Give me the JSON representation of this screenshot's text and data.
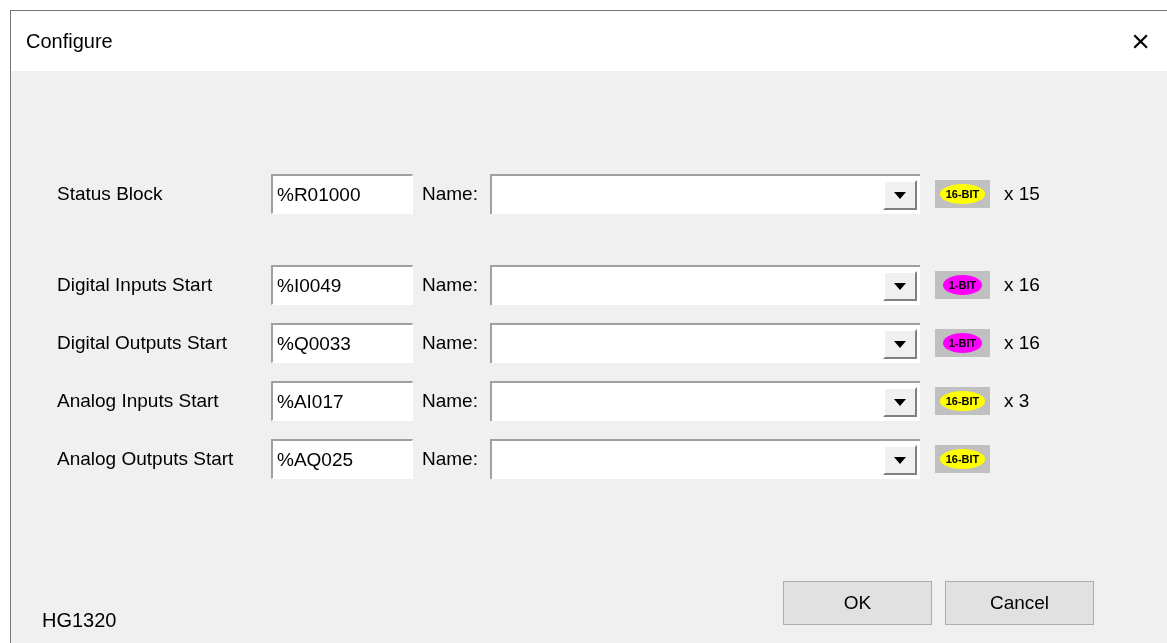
{
  "window": {
    "title": "Configure",
    "close": "×"
  },
  "status_block": {
    "label": "Status Block",
    "address": "%R01000",
    "name_label": "Name:",
    "badge": {
      "label": "16-BIT",
      "color": "#ffff00"
    },
    "count": "x 15"
  },
  "io_points": [
    {
      "label": "Digital Inputs Start",
      "address": "%I0049",
      "name_label": "Name:",
      "badge": {
        "label": "1-BIT",
        "color": "#ff00ff"
      },
      "count": "x 16"
    },
    {
      "label": "Digital Outputs Start",
      "address": "%Q0033",
      "name_label": "Name:",
      "badge": {
        "label": "1-BIT",
        "color": "#ff00ff"
      },
      "count": "x 16"
    },
    {
      "label": "Analog Inputs Start",
      "address": "%AI017",
      "name_label": "Name:",
      "badge": {
        "label": "16-BIT",
        "color": "#ffff00"
      },
      "count": "x 3"
    },
    {
      "label": "Analog Outputs Start",
      "address": "%AQ025",
      "name_label": "Name:",
      "badge": {
        "label": "16-BIT",
        "color": "#ffff00"
      }
    }
  ],
  "footer": {
    "model": "HG1320",
    "buttons": [
      "OK",
      "Cancel"
    ]
  }
}
